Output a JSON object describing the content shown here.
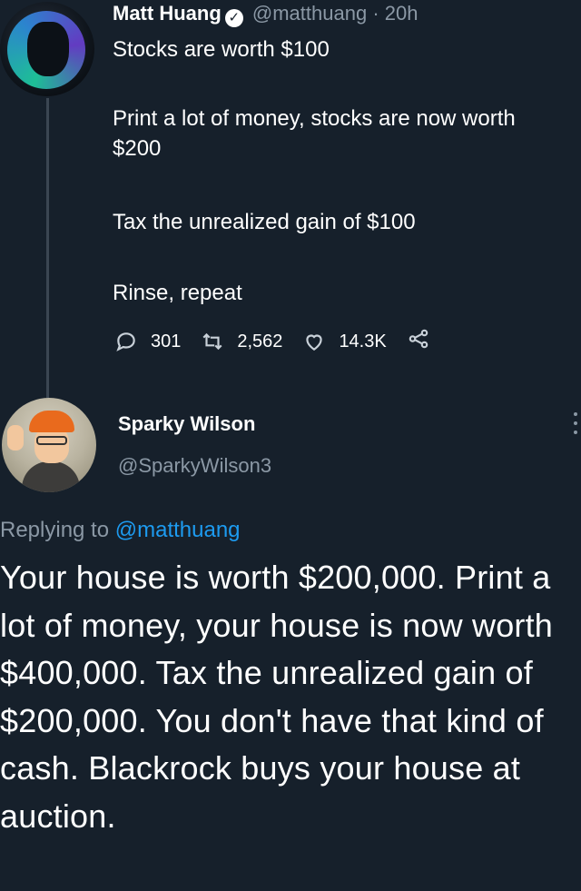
{
  "tweet": {
    "author_name": "Matt Huang",
    "handle": "@matthuang",
    "separator": "·",
    "time": "20h",
    "lines": [
      "Stocks are worth $100",
      "Print a lot of money, stocks are now worth $200",
      "Tax the unrealized gain of $100",
      "Rinse, repeat"
    ],
    "metrics": {
      "replies": "301",
      "retweets": "2,562",
      "likes": "14.3K"
    }
  },
  "reply": {
    "author_name": "Sparky Wilson",
    "handle": "@SparkyWilson3",
    "replying_prefix": "Replying to",
    "replying_to": "@matthuang",
    "body": "Your house is worth $200,000. Print a lot of money, your house is now worth $400,000.  Tax the unrealized gain of $200,000. You don't have that kind of cash. Blackrock buys your house at auction."
  },
  "colors": {
    "background": "#16202b",
    "text": "#ffffff",
    "muted": "#8b98a5",
    "link": "#1d9bf0"
  },
  "icons": [
    "verified-badge-icon",
    "reply-icon",
    "retweet-icon",
    "like-icon",
    "share-icon",
    "more-options-icon"
  ]
}
